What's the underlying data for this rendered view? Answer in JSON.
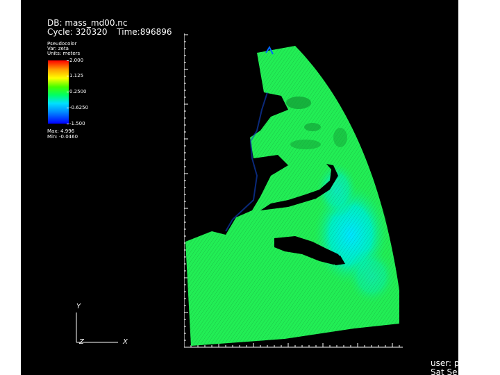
{
  "database_label": "DB: mass_md00.nc",
  "cycle_label": "Cycle: 320320",
  "time_label": "Time:896896",
  "legend": {
    "plot_type": "Pseudocolor",
    "variable": "Var: zeta",
    "units": "Units: meters",
    "ticks": [
      "2.000",
      "1.125",
      "0.2500",
      "-0.6250",
      "-1.500"
    ],
    "max_label": "Max: 4.996",
    "min_label": "Min: -0.0460",
    "colors": [
      "#ff0000",
      "#ffa500",
      "#ffff00",
      "#44ff00",
      "#00ff66",
      "#00e0ff",
      "#0088ff",
      "#0000ff"
    ]
  },
  "triad": {
    "y_label": "Y",
    "z_label": "Z",
    "x_label": "X"
  },
  "footer": {
    "user_label": "user: p",
    "date_label": "Sat Se"
  },
  "colors": {
    "background": "#000000",
    "mesh_green": "#22ee55",
    "mesh_cyan": "#00d8ff",
    "land": "#000000"
  }
}
